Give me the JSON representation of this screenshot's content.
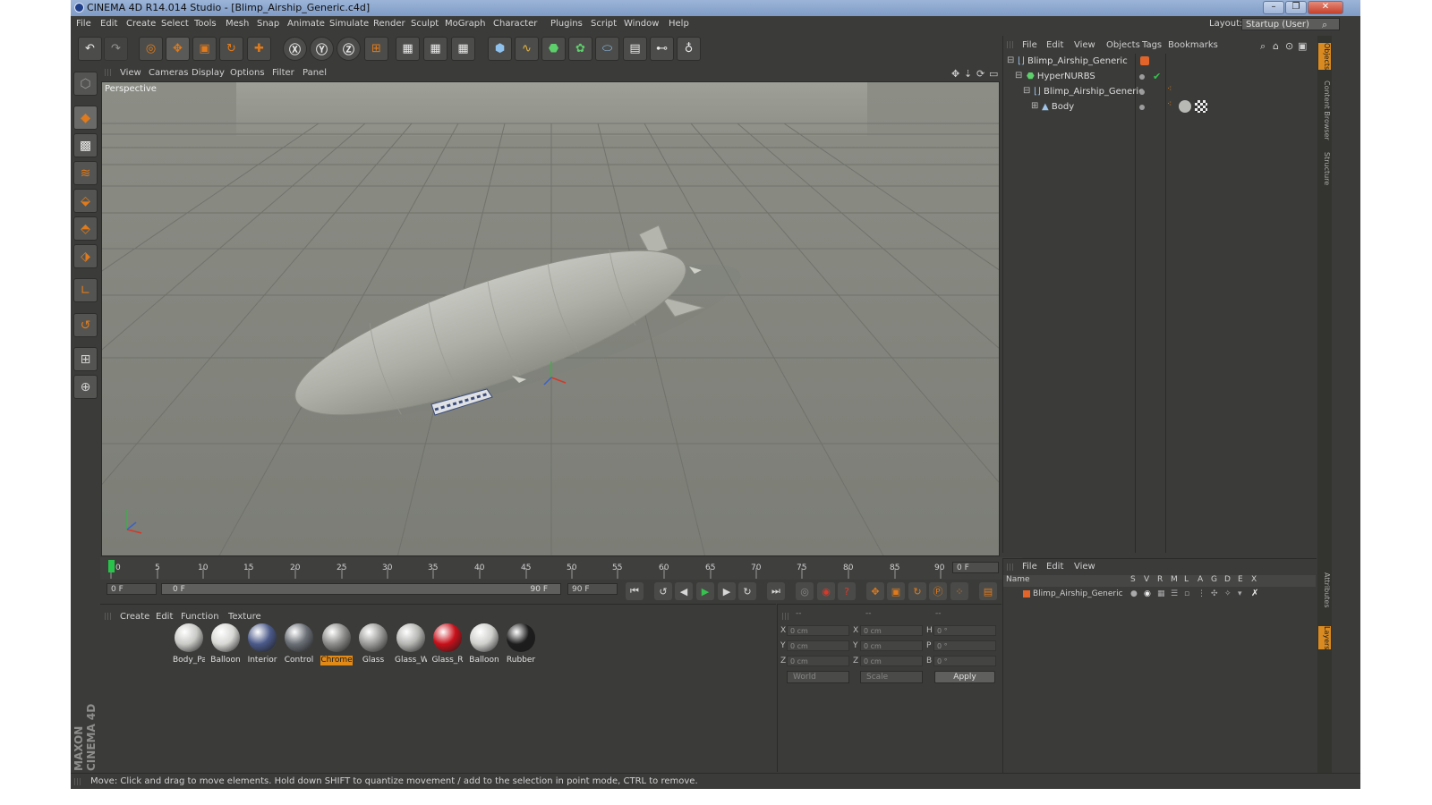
{
  "window": {
    "title": "CINEMA 4D R14.014 Studio - [Blimp_Airship_Generic.c4d]",
    "min_glyph": "–",
    "max_glyph": "❐",
    "close_glyph": "✕"
  },
  "menubar": {
    "items": [
      "File",
      "Edit",
      "Create",
      "Select",
      "Tools",
      "Mesh",
      "Snap",
      "Animate",
      "Simulate",
      "Render",
      "Sculpt",
      "MoGraph",
      "Character",
      "Plugins",
      "Script",
      "Window",
      "Help"
    ],
    "layout_label": "Layout:",
    "layout_value": "Startup (User)"
  },
  "viewport": {
    "menu": [
      "View",
      "Cameras",
      "Display",
      "Options",
      "Filter",
      "Panel"
    ],
    "camera_label": "Perspective"
  },
  "timeline": {
    "ticks": [
      "0",
      "5",
      "10",
      "15",
      "20",
      "25",
      "30",
      "35",
      "40",
      "45",
      "50",
      "55",
      "60",
      "65",
      "70",
      "75",
      "80",
      "85",
      "90"
    ],
    "current_frame": "0 F",
    "start_frame": "0 F",
    "range_start": "0 F",
    "range_end": "90 F",
    "end_frame": "90 F"
  },
  "materials": {
    "menu": [
      "Create",
      "Edit",
      "Function",
      "Texture"
    ],
    "items": [
      {
        "label": "Body_Pa",
        "color": "#c9cac6",
        "selected": false
      },
      {
        "label": "Balloon",
        "color": "#d7d8d4",
        "selected": false
      },
      {
        "label": "Interior",
        "color": "#4b5a8a",
        "selected": false
      },
      {
        "label": "Control",
        "color": "#6a6f76",
        "selected": false
      },
      {
        "label": "Chrome",
        "color": "#8c8d8a",
        "selected": true
      },
      {
        "label": "Glass",
        "color": "#9a9b98",
        "selected": false
      },
      {
        "label": "Glass_W",
        "color": "#b5b6b2",
        "selected": false
      },
      {
        "label": "Glass_R",
        "color": "#c8101a",
        "selected": false
      },
      {
        "label": "Balloon",
        "color": "#cfd0cc",
        "selected": false
      },
      {
        "label": "Rubber",
        "color": "#1d1d1d",
        "selected": false
      }
    ]
  },
  "coords": {
    "header": [
      "--",
      "--",
      "--"
    ],
    "pos_labels": [
      "X",
      "Y",
      "Z"
    ],
    "size_labels": [
      "X",
      "Y",
      "Z"
    ],
    "rot_labels": [
      "H",
      "P",
      "B"
    ],
    "pos_values": [
      "0 cm",
      "0 cm",
      "0 cm"
    ],
    "size_values": [
      "0 cm",
      "0 cm",
      "0 cm"
    ],
    "rot_values": [
      "0 °",
      "0 °",
      "0 °"
    ],
    "mode_world": "World",
    "mode_scale": "Scale",
    "apply": "Apply"
  },
  "objects": {
    "menu": [
      "File",
      "Edit",
      "View",
      "Objects",
      "Tags",
      "Bookmarks"
    ],
    "rows": [
      {
        "label": "Blimp_Airship_Generic",
        "indent": 0
      },
      {
        "label": "HyperNURBS",
        "indent": 1
      },
      {
        "label": "Blimp_Airship_Generic",
        "indent": 2
      },
      {
        "label": "Body",
        "indent": 3
      }
    ],
    "check_glyph": "✔"
  },
  "layers": {
    "menu": [
      "File",
      "Edit",
      "View"
    ],
    "columns": [
      "Name",
      "S",
      "V",
      "R",
      "M",
      "L",
      "A",
      "G",
      "D",
      "E",
      "X"
    ],
    "rows": [
      {
        "label": "Blimp_Airship_Generic"
      }
    ]
  },
  "sidetabs": [
    "Objects",
    "Content Browser",
    "Structure",
    "Attributes",
    "Layers"
  ],
  "status": "Move: Click and drag to move elements. Hold down SHIFT to quantize movement / add to the selection in point mode, CTRL to remove.",
  "logo": "MAXON CINEMA 4D",
  "colors": {
    "accent": "#e28a18",
    "panel": "#3b3c3a",
    "viewport": "#8d8f87"
  }
}
